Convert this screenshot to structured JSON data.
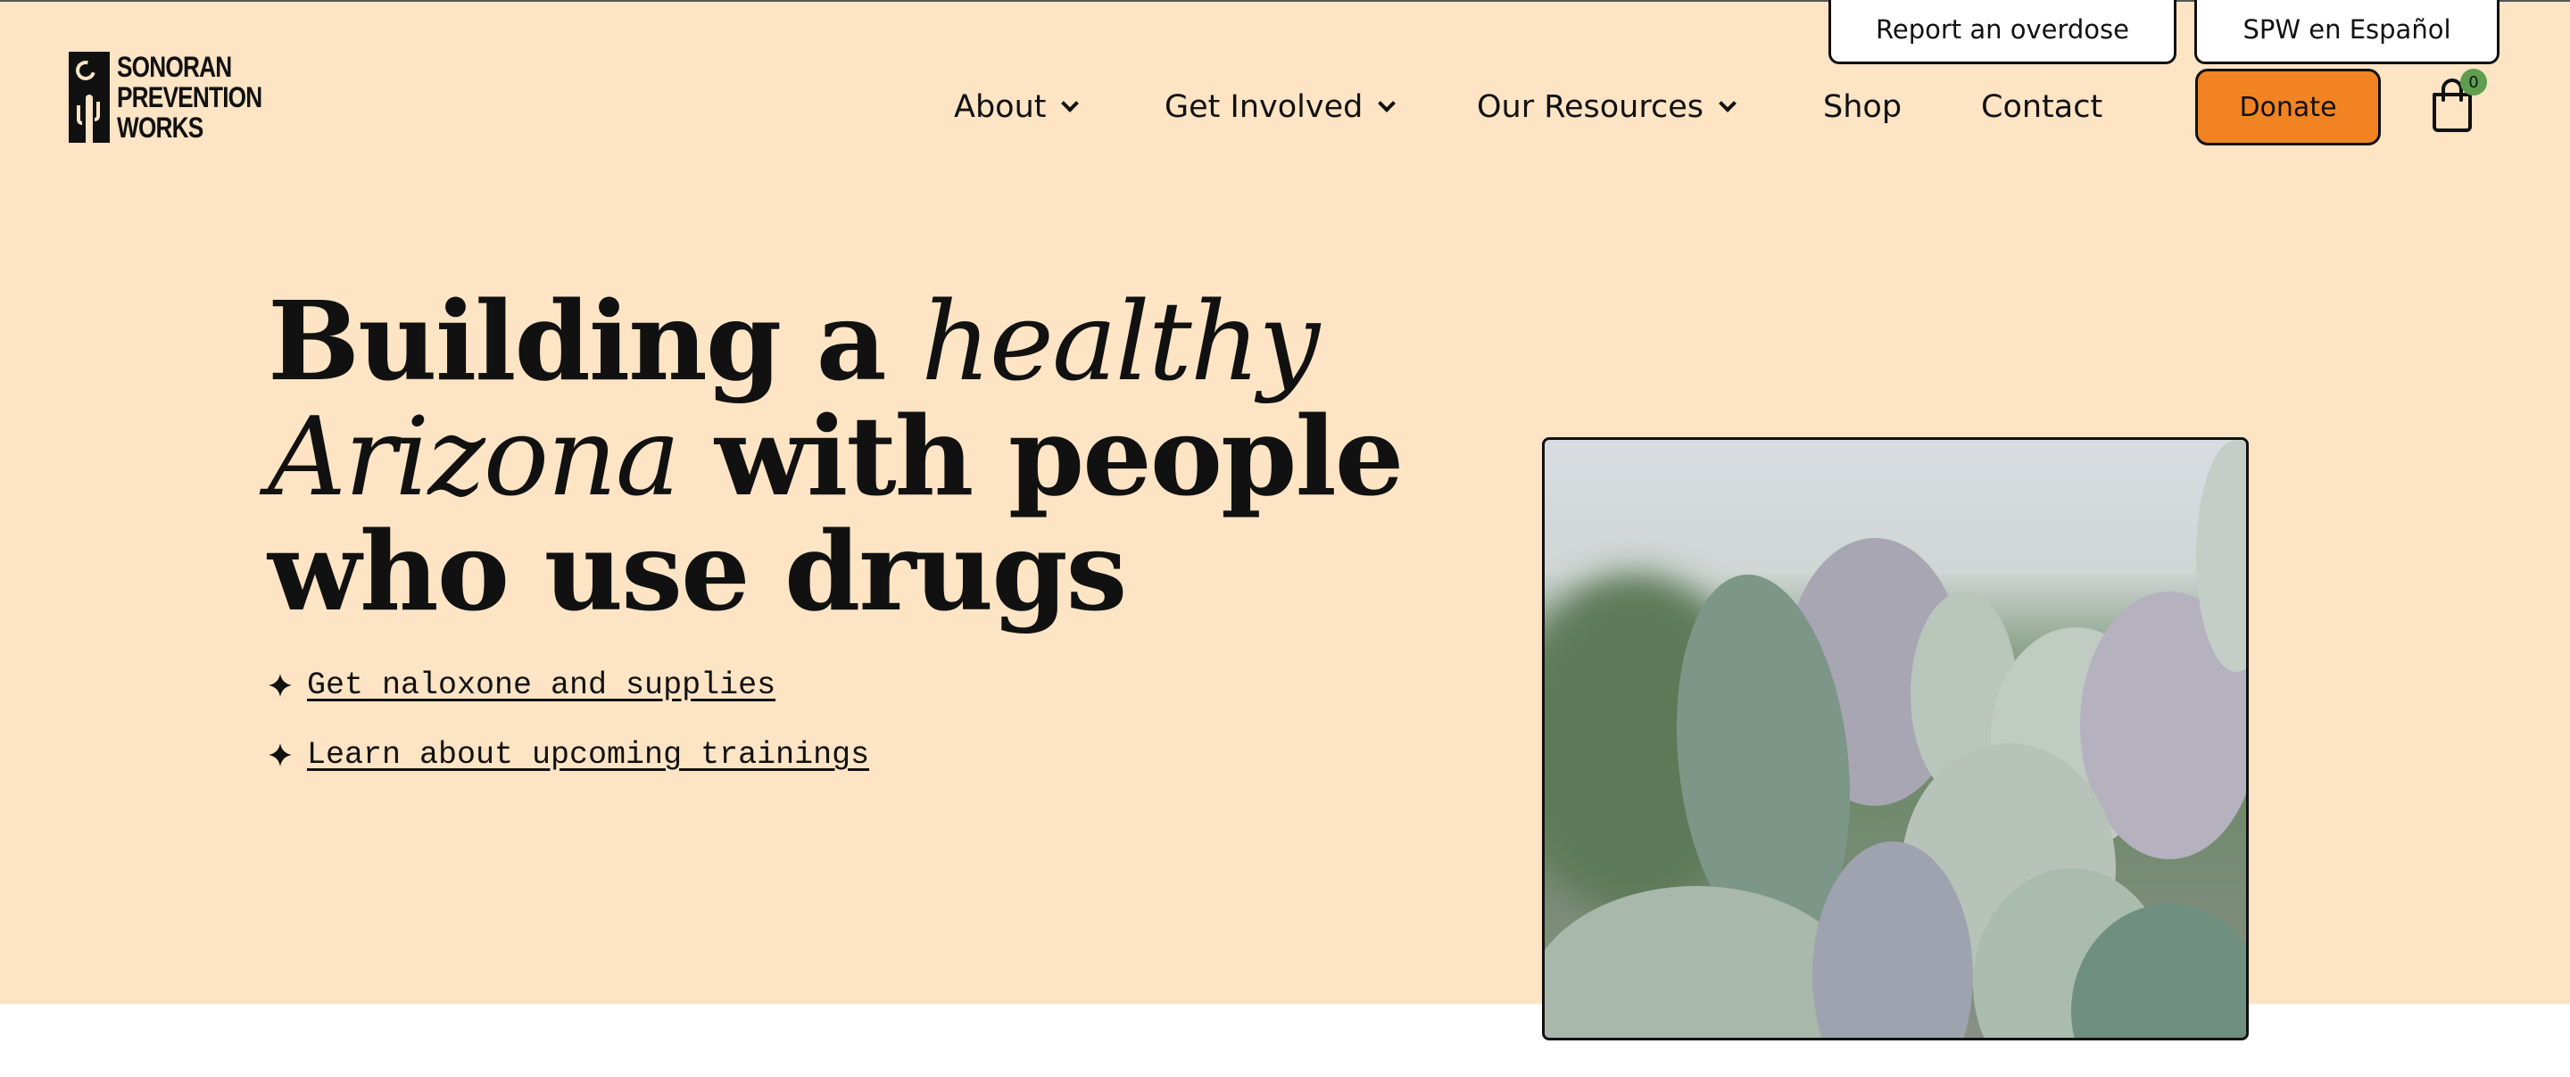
{
  "brand": {
    "logo_lines": [
      "SONORAN",
      "PREVENTION",
      "WORKS"
    ]
  },
  "utility": {
    "report_label": "Report an overdose",
    "spanish_label": "SPW en Español"
  },
  "nav": {
    "items": [
      {
        "label": "About",
        "has_dropdown": true
      },
      {
        "label": "Get Involved",
        "has_dropdown": true
      },
      {
        "label": "Our Resources",
        "has_dropdown": true
      },
      {
        "label": "Shop",
        "has_dropdown": false
      },
      {
        "label": "Contact",
        "has_dropdown": false
      }
    ],
    "donate_label": "Donate",
    "cart_count": "0"
  },
  "hero": {
    "headline": {
      "part1": "Building a ",
      "part2_italic": "healthy",
      "part3_italic": "Arizona",
      "part4": " with people",
      "part5": "who use drugs"
    },
    "links": [
      "Get naloxone and supplies",
      "Learn about upcoming trainings"
    ]
  },
  "colors": {
    "hero_background": "#fce4c4",
    "donate_accent": "#f28322",
    "cart_badge": "#5f9e4e"
  }
}
